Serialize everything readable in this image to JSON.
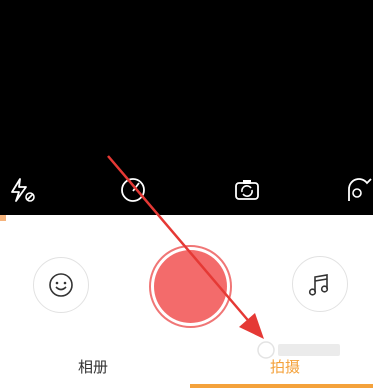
{
  "camera": {
    "top_icons": [
      "flash-off-icon",
      "speed-icon",
      "flip-camera-icon",
      "beauty-icon"
    ]
  },
  "controls": {
    "left_button_icon": "smiley-face-icon",
    "shutter_icon": "record-icon",
    "right_button_icon": "music-note-icon"
  },
  "tabs": {
    "album_label": "相册",
    "shoot_label": "拍摄",
    "active": "拍摄"
  },
  "colors": {
    "shutter": "#f36b6b",
    "active_tab": "#f4a23c",
    "annotation_arrow": "#e53935"
  }
}
